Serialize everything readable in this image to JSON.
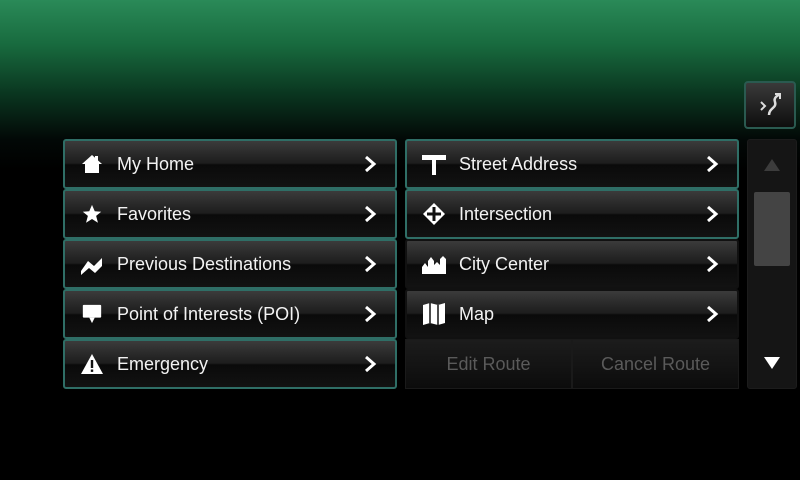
{
  "left_menu": [
    {
      "label": "My Home",
      "icon": "home-icon"
    },
    {
      "label": "Favorites",
      "icon": "star-icon"
    },
    {
      "label": "Previous Destinations",
      "icon": "route-icon"
    },
    {
      "label": "Point of Interests (POI)",
      "icon": "poi-icon"
    },
    {
      "label": "Emergency",
      "icon": "warning-icon"
    }
  ],
  "right_menu": [
    {
      "label": "Street Address",
      "icon": "street-sign-icon"
    },
    {
      "label": "Intersection",
      "icon": "intersection-icon"
    },
    {
      "label": "City Center",
      "icon": "city-icon"
    },
    {
      "label": "Map",
      "icon": "map-icon"
    }
  ],
  "route_actions": {
    "edit": "Edit Route",
    "cancel": "Cancel Route"
  },
  "colors": {
    "accent_border": "#2f6e66",
    "header_green": "#2a8a58",
    "disabled_text": "#5a5a5a"
  }
}
